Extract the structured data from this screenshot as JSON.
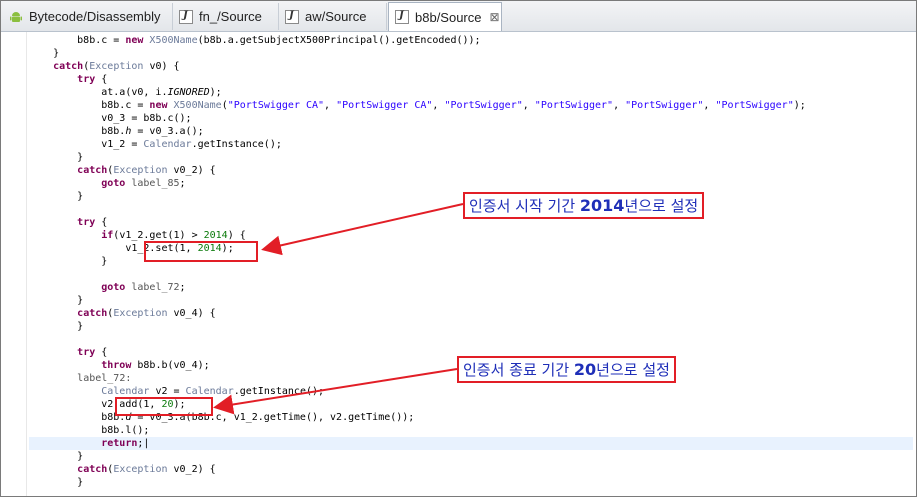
{
  "tabs": [
    {
      "label": "Bytecode/Disassembly",
      "icon": "android-icon"
    },
    {
      "label": "fn_/Source",
      "icon": "java-file-icon"
    },
    {
      "label": "aw/Source",
      "icon": "java-file-icon"
    },
    {
      "label": "b8b/Source",
      "icon": "java-file-icon",
      "active": true,
      "close": "⊠"
    }
  ],
  "annotations": [
    {
      "prefix": "인증서 시작 기간 ",
      "bold": "2014",
      "suffix": "년으로 설정"
    },
    {
      "prefix": "인증서 종료 기간 ",
      "bold": "20",
      "suffix": "년으로 설정"
    }
  ],
  "colors": {
    "annotation_border": "#e21e26",
    "annotation_text": "#1f2fb8",
    "keyword": "#7f0055",
    "string": "#2a00ff"
  },
  "code": [
    [
      {
        "t": "        b8b.c = "
      },
      {
        "t": "new",
        "k": "kw"
      },
      {
        "t": " "
      },
      {
        "t": "X500Name",
        "k": "ty"
      },
      {
        "t": "(b8b.a.getSubjectX500Principal().getEncoded());"
      }
    ],
    [
      {
        "t": "    }"
      }
    ],
    [
      {
        "t": "    "
      },
      {
        "t": "catch",
        "k": "kw"
      },
      {
        "t": "("
      },
      {
        "t": "Exception",
        "k": "ty"
      },
      {
        "t": " v0) {"
      }
    ],
    [
      {
        "t": "        "
      },
      {
        "t": "try",
        "k": "kw"
      },
      {
        "t": " {"
      }
    ],
    [
      {
        "t": "            at.a(v0, i."
      },
      {
        "t": "IGNORED",
        "k": "fld"
      },
      {
        "t": ");"
      }
    ],
    [
      {
        "t": "            b8b.c = "
      },
      {
        "t": "new",
        "k": "kw"
      },
      {
        "t": " "
      },
      {
        "t": "X500Name",
        "k": "ty"
      },
      {
        "t": "("
      },
      {
        "t": "\"PortSwigger CA\"",
        "k": "str"
      },
      {
        "t": ", "
      },
      {
        "t": "\"PortSwigger CA\"",
        "k": "str"
      },
      {
        "t": ", "
      },
      {
        "t": "\"PortSwigger\"",
        "k": "str"
      },
      {
        "t": ", "
      },
      {
        "t": "\"PortSwigger\"",
        "k": "str"
      },
      {
        "t": ", "
      },
      {
        "t": "\"PortSwigger\"",
        "k": "str"
      },
      {
        "t": ", "
      },
      {
        "t": "\"PortSwigger\"",
        "k": "str"
      },
      {
        "t": ");"
      }
    ],
    [
      {
        "t": "            v0_3 = b8b.c();"
      }
    ],
    [
      {
        "t": "            b8b."
      },
      {
        "t": "h",
        "k": "fld"
      },
      {
        "t": " = v0_3.a();"
      }
    ],
    [
      {
        "t": "            v1_2 = "
      },
      {
        "t": "Calendar",
        "k": "ty"
      },
      {
        "t": ".getInstance();"
      }
    ],
    [
      {
        "t": "        }"
      }
    ],
    [
      {
        "t": "        "
      },
      {
        "t": "catch",
        "k": "kw"
      },
      {
        "t": "("
      },
      {
        "t": "Exception",
        "k": "ty"
      },
      {
        "t": " v0_2) {"
      }
    ],
    [
      {
        "t": "            "
      },
      {
        "t": "goto",
        "k": "kw"
      },
      {
        "t": " "
      },
      {
        "t": "label_85",
        "k": "lbl"
      },
      {
        "t": ";"
      }
    ],
    [
      {
        "t": "        }"
      }
    ],
    [
      {
        "t": ""
      }
    ],
    [
      {
        "t": "        "
      },
      {
        "t": "try",
        "k": "kw"
      },
      {
        "t": " {"
      }
    ],
    [
      {
        "t": "            "
      },
      {
        "t": "if",
        "k": "kw"
      },
      {
        "t": "(v1_2.get(1) > "
      },
      {
        "t": "2014",
        "k": "num"
      },
      {
        "t": ") {"
      }
    ],
    [
      {
        "t": "                v1_2.set(1, "
      },
      {
        "t": "2014",
        "k": "num"
      },
      {
        "t": ");"
      }
    ],
    [
      {
        "t": "            }"
      }
    ],
    [
      {
        "t": ""
      }
    ],
    [
      {
        "t": "            "
      },
      {
        "t": "goto",
        "k": "kw"
      },
      {
        "t": " "
      },
      {
        "t": "label_72",
        "k": "lbl"
      },
      {
        "t": ";"
      }
    ],
    [
      {
        "t": "        }"
      }
    ],
    [
      {
        "t": "        "
      },
      {
        "t": "catch",
        "k": "kw"
      },
      {
        "t": "("
      },
      {
        "t": "Exception",
        "k": "ty"
      },
      {
        "t": " v0_4) {"
      }
    ],
    [
      {
        "t": "        }"
      }
    ],
    [
      {
        "t": ""
      }
    ],
    [
      {
        "t": "        "
      },
      {
        "t": "try",
        "k": "kw"
      },
      {
        "t": " {"
      }
    ],
    [
      {
        "t": "            "
      },
      {
        "t": "throw",
        "k": "kw"
      },
      {
        "t": " b8b.b(v0_4);"
      }
    ],
    [
      {
        "t": "        "
      },
      {
        "t": "label_72:",
        "k": "lbl"
      }
    ],
    [
      {
        "t": "            "
      },
      {
        "t": "Calendar",
        "k": "ty"
      },
      {
        "t": " v2 = "
      },
      {
        "t": "Calendar",
        "k": "ty"
      },
      {
        "t": ".getInstance();"
      }
    ],
    [
      {
        "t": "            v2.add(1, "
      },
      {
        "t": "20",
        "k": "num"
      },
      {
        "t": ");"
      }
    ],
    [
      {
        "t": "            b8b."
      },
      {
        "t": "d",
        "k": "fld"
      },
      {
        "t": " = v0_3.a(b8b.c, v1_2.getTime(), v2.getTime());"
      }
    ],
    [
      {
        "t": "            b8b.l();"
      }
    ],
    [
      {
        "t": "            "
      },
      {
        "t": "return",
        "k": "kw"
      },
      {
        "t": ";|"
      }
    ],
    [
      {
        "t": "        }"
      }
    ],
    [
      {
        "t": "        "
      },
      {
        "t": "catch",
        "k": "kw"
      },
      {
        "t": "("
      },
      {
        "t": "Exception",
        "k": "ty"
      },
      {
        "t": " v0_2) {"
      }
    ],
    [
      {
        "t": "        }"
      }
    ]
  ]
}
